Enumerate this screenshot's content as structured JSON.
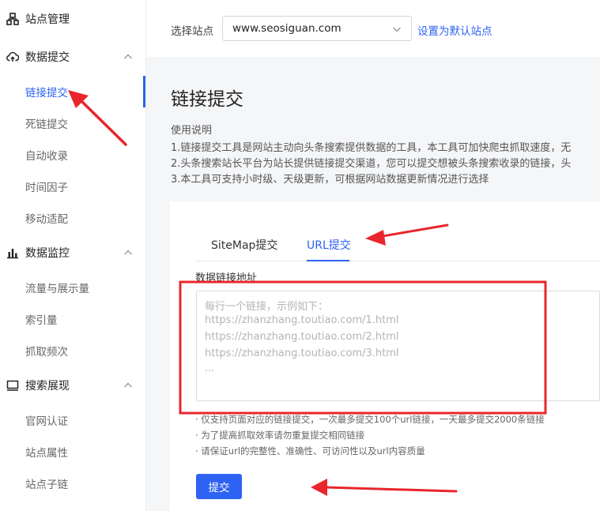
{
  "sidebar": {
    "groups": [
      {
        "label": "站点管理",
        "icon": "sitemap-icon"
      },
      {
        "label": "数据提交",
        "icon": "cloud-upload-icon",
        "expanded": true,
        "items": [
          "链接提交",
          "死链提交",
          "自动收录",
          "时间因子",
          "移动适配"
        ]
      },
      {
        "label": "数据监控",
        "icon": "bar-chart-icon",
        "expanded": true,
        "items": [
          "流量与展示量",
          "索引量",
          "抓取频次"
        ]
      },
      {
        "label": "搜索展现",
        "icon": "monitor-icon",
        "expanded": true,
        "items": [
          "官网认证",
          "站点属性",
          "站点子链"
        ]
      }
    ],
    "active_item": "链接提交"
  },
  "topbar": {
    "site_label": "选择站点",
    "site_value": "www.seosiguan.com",
    "set_default": "设置为默认站点"
  },
  "main": {
    "title": "链接提交",
    "usage_title": "使用说明",
    "usage_lines": [
      "1.链接提交工具是网站主动向头条搜索提供数据的工具，本工具可加快爬虫抓取速度，无",
      "2.头条搜索站长平台为站长提供链接提交渠道，您可以提交想被头条搜索收录的链接，头",
      "3.本工具可支持小时级、天级更新，可根据网站数据更新情况进行选择"
    ],
    "tabs": [
      {
        "label": "SiteMap提交",
        "active": false
      },
      {
        "label": "URL提交",
        "active": true
      }
    ],
    "field_label": "数据链接地址",
    "placeholder_lines": [
      "每行一个链接，示例如下：",
      "https://zhanzhang.toutiao.com/1.html",
      "https://zhanzhang.toutiao.com/2.html",
      "https://zhanzhang.toutiao.com/3.html",
      "..."
    ],
    "notes": [
      "· 仅支持页面对应的链接提交，一次最多提交100个url链接，一天最多提交2000条链接",
      "· 为了提高抓取效率请勿重复提交相同链接",
      "· 请保证url的完整性、准确性、可访问性以及url内容质量"
    ],
    "submit": "提交"
  },
  "colors": {
    "accent": "#2e62f2",
    "annotation": "#e8262c",
    "background": "#f5f6f8"
  }
}
